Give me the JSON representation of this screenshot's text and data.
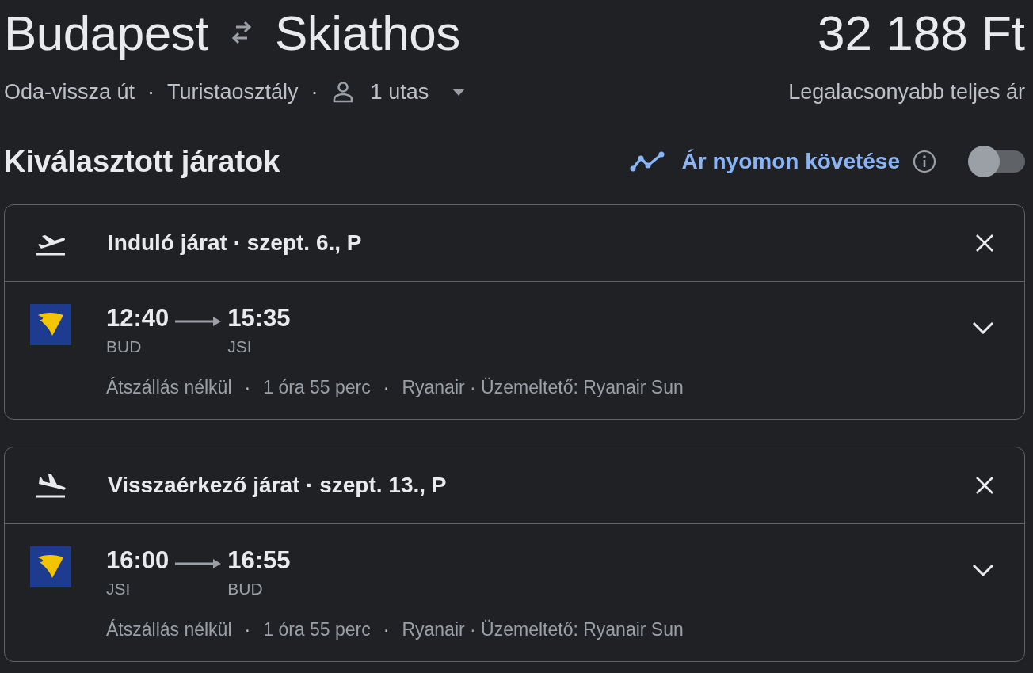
{
  "route": {
    "origin": "Budapest",
    "destination": "Skiathos"
  },
  "price": {
    "amount": "32 188 Ft",
    "note": "Legalacsonyabb teljes ár"
  },
  "trip": {
    "type": "Oda-vissza út",
    "separator_1": "·",
    "cabin": "Turistaosztály",
    "separator_2": "·",
    "passengers": "1 utas"
  },
  "section": {
    "title": "Kiválasztott járatok",
    "tracking": {
      "label": "Ár nyomon követése",
      "on": false
    }
  },
  "flights": [
    {
      "kind": "departure",
      "title": "Induló járat · szept. 6., P",
      "depart_time": "12:40",
      "arrive_time": "15:35",
      "depart_code": "BUD",
      "arrive_code": "JSI",
      "stops": "Átszállás nélkül",
      "separator_1": "·",
      "duration": "1 óra 55 perc",
      "separator_2": "·",
      "airline": "Ryanair · Üzemeltető: Ryanair Sun"
    },
    {
      "kind": "arrival",
      "title": "Visszaérkező járat · szept. 13., P",
      "depart_time": "16:00",
      "arrive_time": "16:55",
      "depart_code": "JSI",
      "arrive_code": "BUD",
      "stops": "Átszállás nélkül",
      "separator_1": "·",
      "duration": "1 óra 55 perc",
      "separator_2": "·",
      "airline": "Ryanair · Üzemeltető: Ryanair Sun"
    }
  ]
}
